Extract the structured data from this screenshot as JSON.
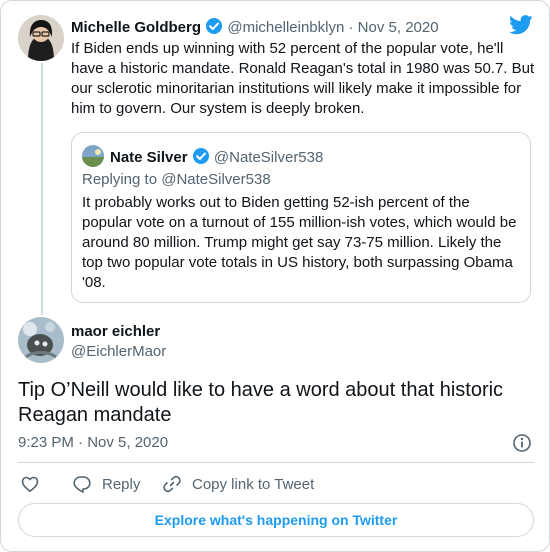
{
  "parent_tweet": {
    "author_name": "Michelle Goldberg",
    "author_handle": "@michelleinbklyn",
    "separator": "·",
    "date": "Nov 5, 2020",
    "text": "If Biden ends up winning with 52 percent of the popular vote, he'll have a historic mandate. Ronald Reagan's total in 1980 was 50.7. But our sclerotic minoritarian institutions will likely make it impossible for him to govern. Our system is deeply broken."
  },
  "quoted_tweet": {
    "author_name": "Nate Silver",
    "author_handle": "@NateSilver538",
    "replying_to_prefix": "Replying to",
    "replying_to_handle": "@NateSilver538",
    "text": "It probably works out to Biden getting 52-ish percent of the popular vote on a turnout of 155 million-ish votes, which would be around 80 million. Trump might get say 73-75 million. Likely the top two popular vote totals in US history, both surpassing Obama '08."
  },
  "main_tweet": {
    "author_name": "maor eichler",
    "author_handle": "@EichlerMaor",
    "text": "Tip O’Neill would like to have a word about that historic Reagan mandate",
    "timestamp": "9:23 PM · Nov 5, 2020"
  },
  "actions": {
    "reply_label": "Reply",
    "copy_link_label": "Copy link to Tweet"
  },
  "explore_label": "Explore what's happening on Twitter",
  "colors": {
    "twitter_blue": "#1d9bf0",
    "text_primary": "#0f1419",
    "text_secondary": "#536471",
    "border": "#cfd9de"
  },
  "icons": [
    "twitter-bird-icon",
    "verified-badge-icon",
    "info-icon",
    "heart-icon",
    "reply-icon",
    "link-icon"
  ]
}
